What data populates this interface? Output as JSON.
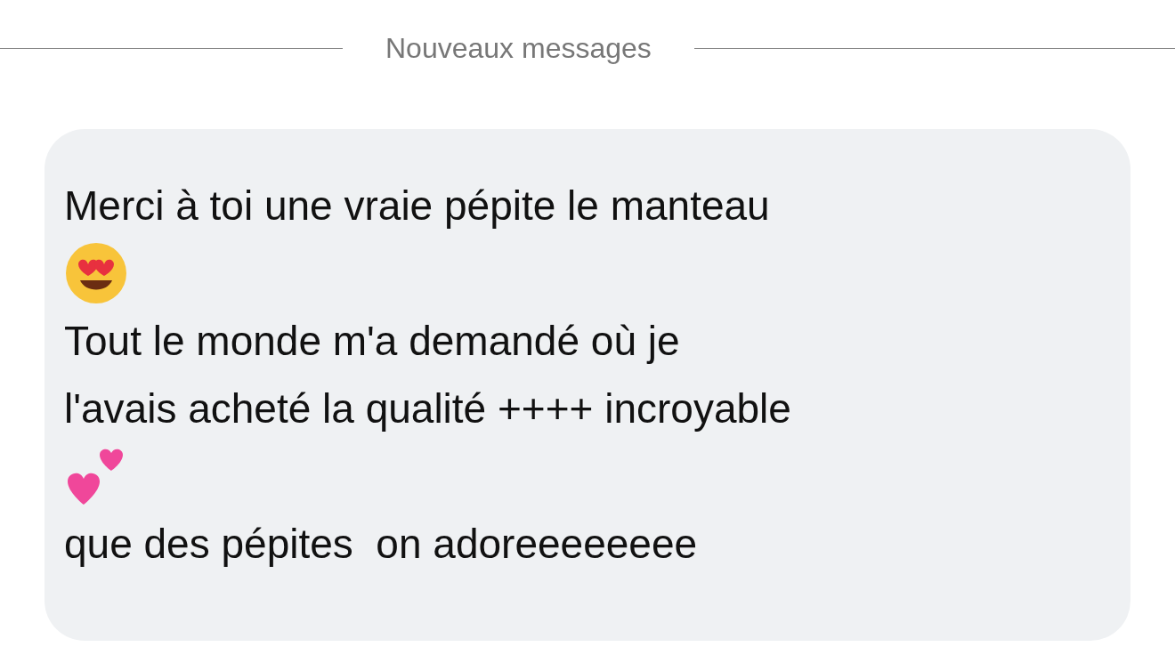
{
  "divider": {
    "label": "Nouveaux messages"
  },
  "message": {
    "lines": [
      {
        "kind": "text",
        "text": "Merci à toi une vraie pépite le manteau"
      },
      {
        "kind": "face"
      },
      {
        "kind": "text",
        "text": "Tout le monde m'a demandé où je"
      },
      {
        "kind": "text",
        "text": "l'avais acheté la qualité ++++ incroyable"
      },
      {
        "kind": "hearts"
      },
      {
        "kind": "text",
        "text": "que des pépites  on adoreeeeeeee"
      }
    ]
  }
}
